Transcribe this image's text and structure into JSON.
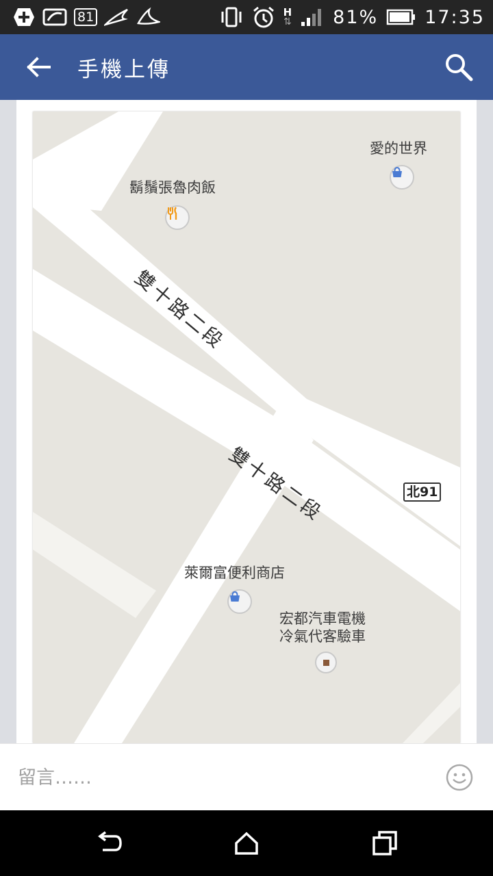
{
  "status_bar": {
    "notif_count": "81",
    "network_type": "H",
    "battery_percent": "81%",
    "time": "17:35",
    "icons": [
      "add-icon",
      "image-icon",
      "notification-count-icon",
      "bird-icon",
      "bird-icon",
      "vibrate-icon",
      "alarm-icon",
      "data-arrows-icon",
      "signal-icon",
      "battery-icon"
    ]
  },
  "app_bar": {
    "title": "手機上傳",
    "back_icon": "arrow-left-icon",
    "search_icon": "search-icon",
    "color": "#3b5998"
  },
  "map": {
    "background": "#e7e5df",
    "pois": [
      {
        "name": "鬍鬚張魯肉飯",
        "icon": "restaurant-icon",
        "color": "#f29b1a"
      },
      {
        "name": "愛的世界",
        "icon": "shopping-bag-icon",
        "color": "#4a7bd3"
      },
      {
        "name": "萊爾富便利商店",
        "icon": "shopping-bag-icon",
        "color": "#4a7bd3"
      },
      {
        "name_line1": "宏都汽車電機",
        "name_line2": "冷氣代客驗車",
        "icon": "generic-place-icon",
        "color": "#8a5a3a"
      }
    ],
    "roads": [
      {
        "name": "雙十路二段"
      },
      {
        "name": "雙十路二段"
      }
    ],
    "route_shield": "北91"
  },
  "comment_bar": {
    "placeholder": "留言……",
    "emoji_icon": "smiley-icon"
  },
  "nav_bar": {
    "icons": [
      "back-nav-icon",
      "home-icon",
      "recent-apps-icon"
    ]
  }
}
